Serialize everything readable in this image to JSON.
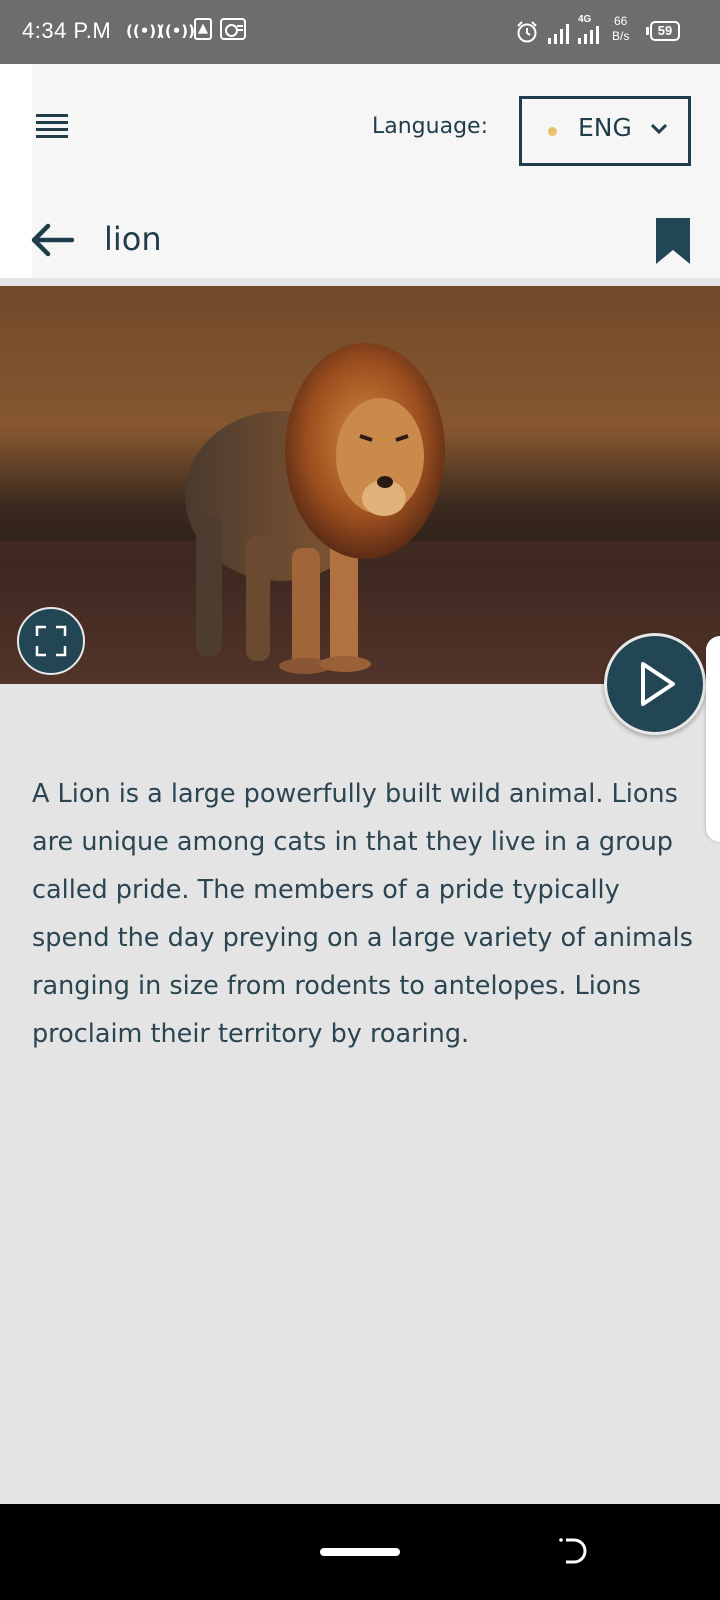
{
  "status_bar": {
    "time": "4:34 P.M",
    "network": "4G",
    "speed_value": "66",
    "speed_unit": "B/s",
    "battery": "59"
  },
  "header": {
    "language_label": "Language:",
    "language_value": "ENG",
    "title": "lion"
  },
  "content": {
    "description": "A Lion is a large powerfully built wild animal. Lions are unique among cats in that they live in a group called pride. The members of a pride typically spend the day preying on a large variety of animals ranging in size from rodents to antelopes. Lions proclaim their territory by roaring."
  },
  "colors": {
    "accent": "#1f3d4a",
    "button_bg": "#234654",
    "background": "#e4e4e4",
    "header_bg": "#f7f6f7",
    "language_dot": "#e6c26a"
  },
  "icons": {
    "menu": "hamburger-icon",
    "language_dropdown": "chevron-down-icon",
    "back": "arrow-left-icon",
    "bookmark": "bookmark-icon",
    "fullscreen": "fullscreen-icon",
    "play": "play-icon",
    "nav_rotate": "rotate-icon"
  }
}
